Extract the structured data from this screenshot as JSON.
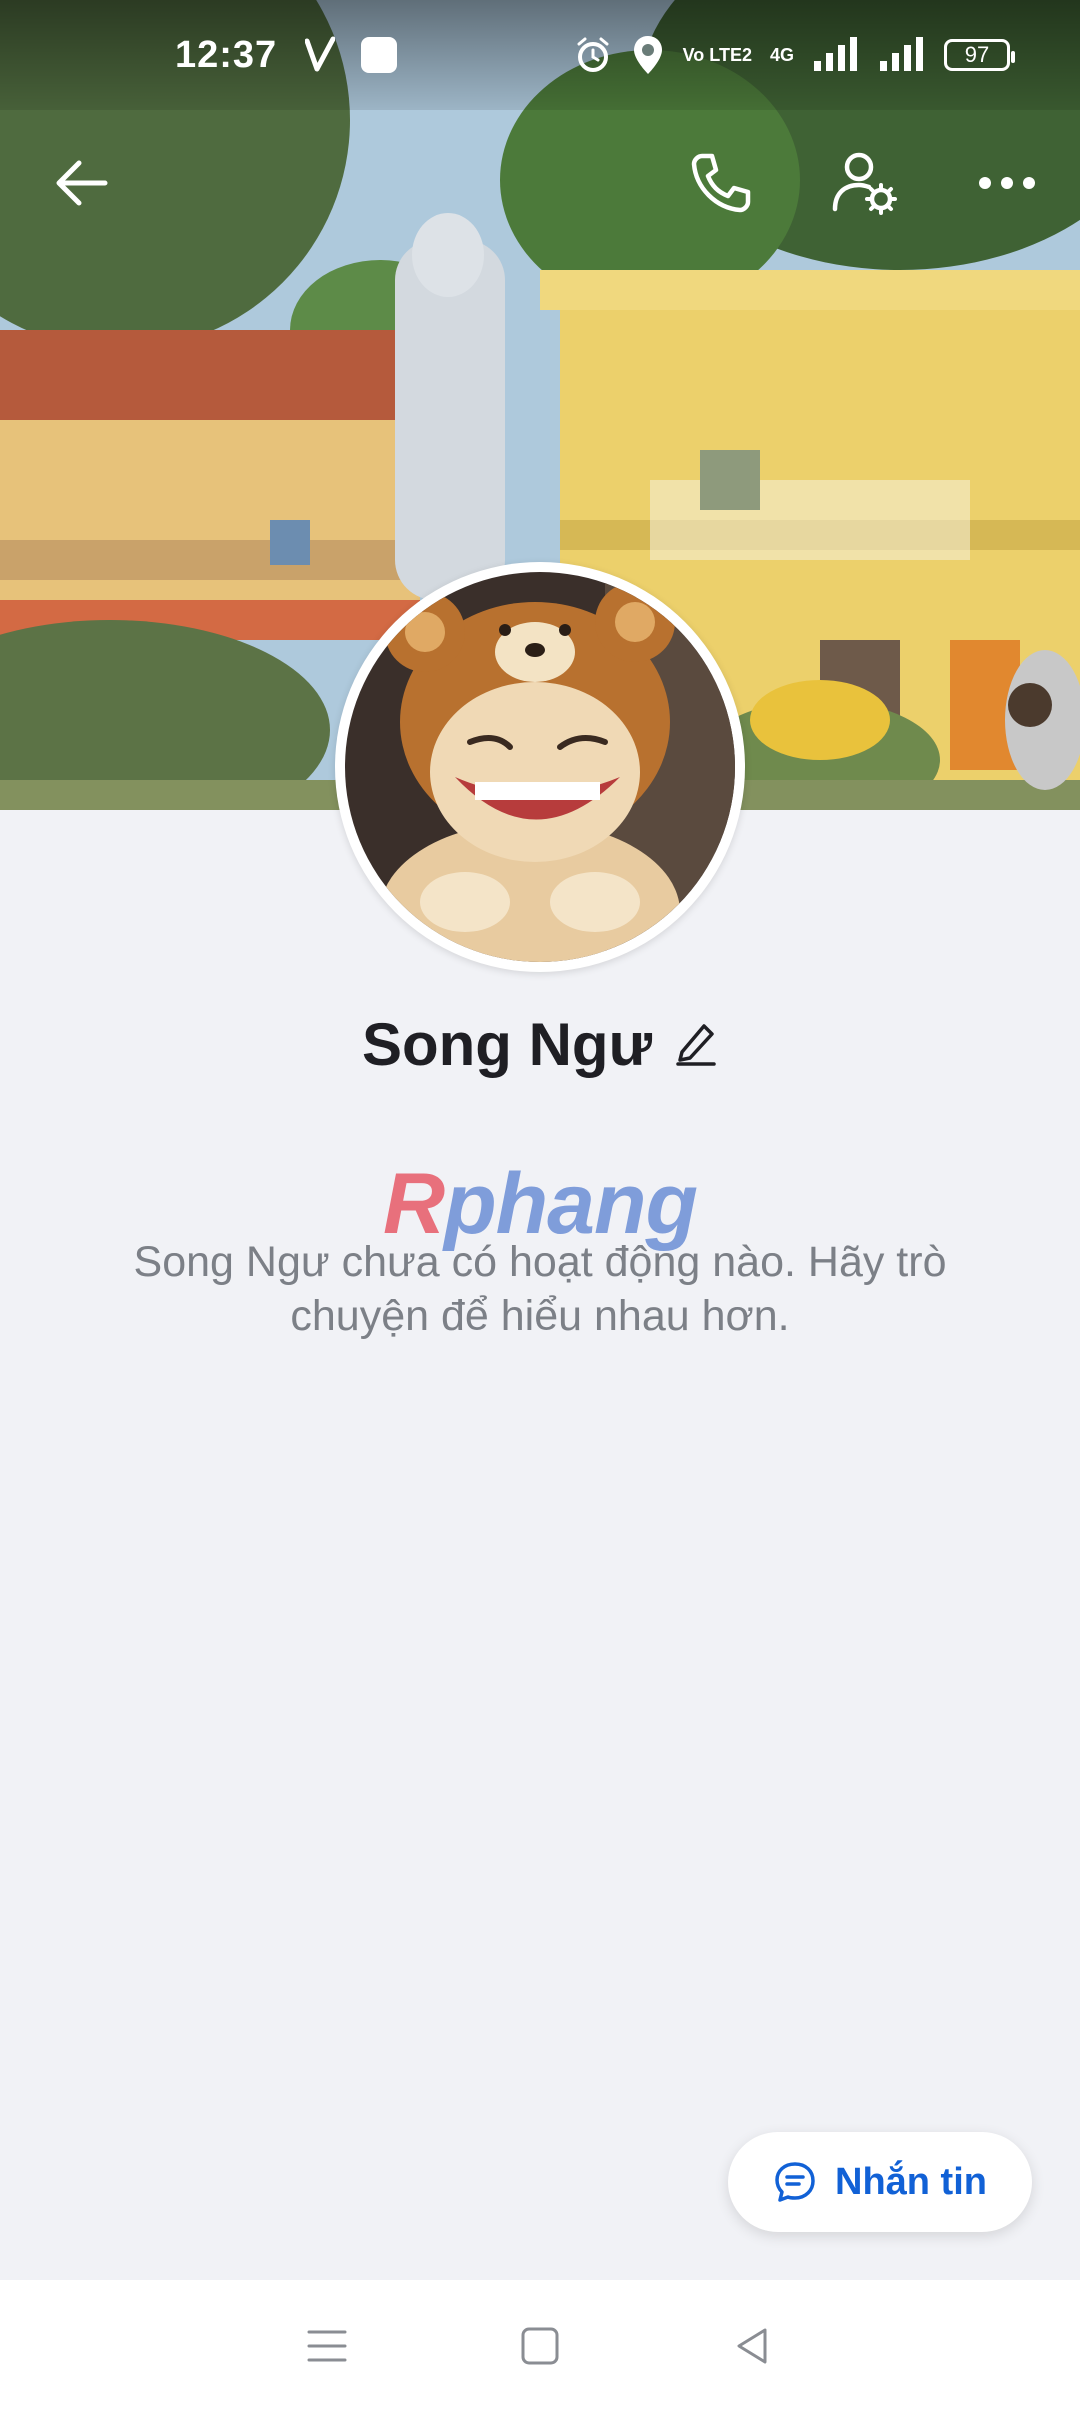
{
  "status_bar": {
    "time": "12:37",
    "battery": "97",
    "volte_label": "Vo LTE2",
    "network_label": "4G"
  },
  "header": {
    "back_icon": "arrow-left-icon",
    "call_icon": "phone-icon",
    "settings_icon": "user-settings-icon",
    "more_icon": "more-horizontal-icon"
  },
  "profile": {
    "name": "Song Ngư",
    "edit_icon": "pencil-icon",
    "empty_message": "Song Ngư chưa có hoạt động nào. Hãy trò chuyện để hiểu nhau hơn."
  },
  "watermark": {
    "text": "Rphang"
  },
  "actions": {
    "message_label": "Nhắn tin",
    "message_icon": "chat-bubble-icon"
  },
  "colors": {
    "accent": "#1161D6",
    "background": "#F1F2F6",
    "name_text": "#1F1F24",
    "secondary_text": "#7C8087"
  }
}
